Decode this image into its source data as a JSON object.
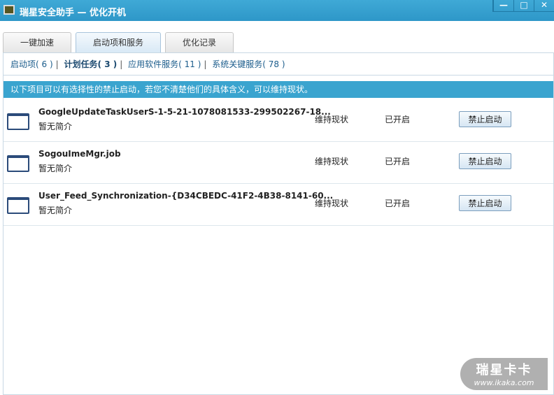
{
  "window": {
    "title": "瑞星安全助手 — 优化开机",
    "minimize": "—",
    "maximize": "□",
    "close": "✕"
  },
  "tabs": [
    {
      "label": "一键加速"
    },
    {
      "label": "启动项和服务"
    },
    {
      "label": "优化记录"
    }
  ],
  "subnav": [
    {
      "label": "启动项",
      "count": "( 6 )"
    },
    {
      "label": "计划任务",
      "count": "( 3 )"
    },
    {
      "label": "应用软件服务",
      "count": "( 11 )"
    },
    {
      "label": "系统关键服务",
      "count": "( 78 )"
    }
  ],
  "separator": "|",
  "banner": "以下项目可以有选择性的禁止启动，若您不清楚他们的具体含义，可以维持现状。",
  "rows": [
    {
      "name": "GoogleUpdateTaskUserS-1-5-21-1078081533-299502267-18...",
      "desc": "暂无简介",
      "action": "维持现状",
      "status": "已开启",
      "button": "禁止启动"
    },
    {
      "name": "SogouImeMgr.job",
      "desc": "暂无简介",
      "action": "维持现状",
      "status": "已开启",
      "button": "禁止启动"
    },
    {
      "name": "User_Feed_Synchronization-{D34CBEDC-41F2-4B38-8141-60...",
      "desc": "暂无简介",
      "action": "维持现状",
      "status": "已开启",
      "button": "禁止启动"
    }
  ],
  "logo": {
    "brand": "瑞星卡卡",
    "url": "www.ikaka.com"
  }
}
